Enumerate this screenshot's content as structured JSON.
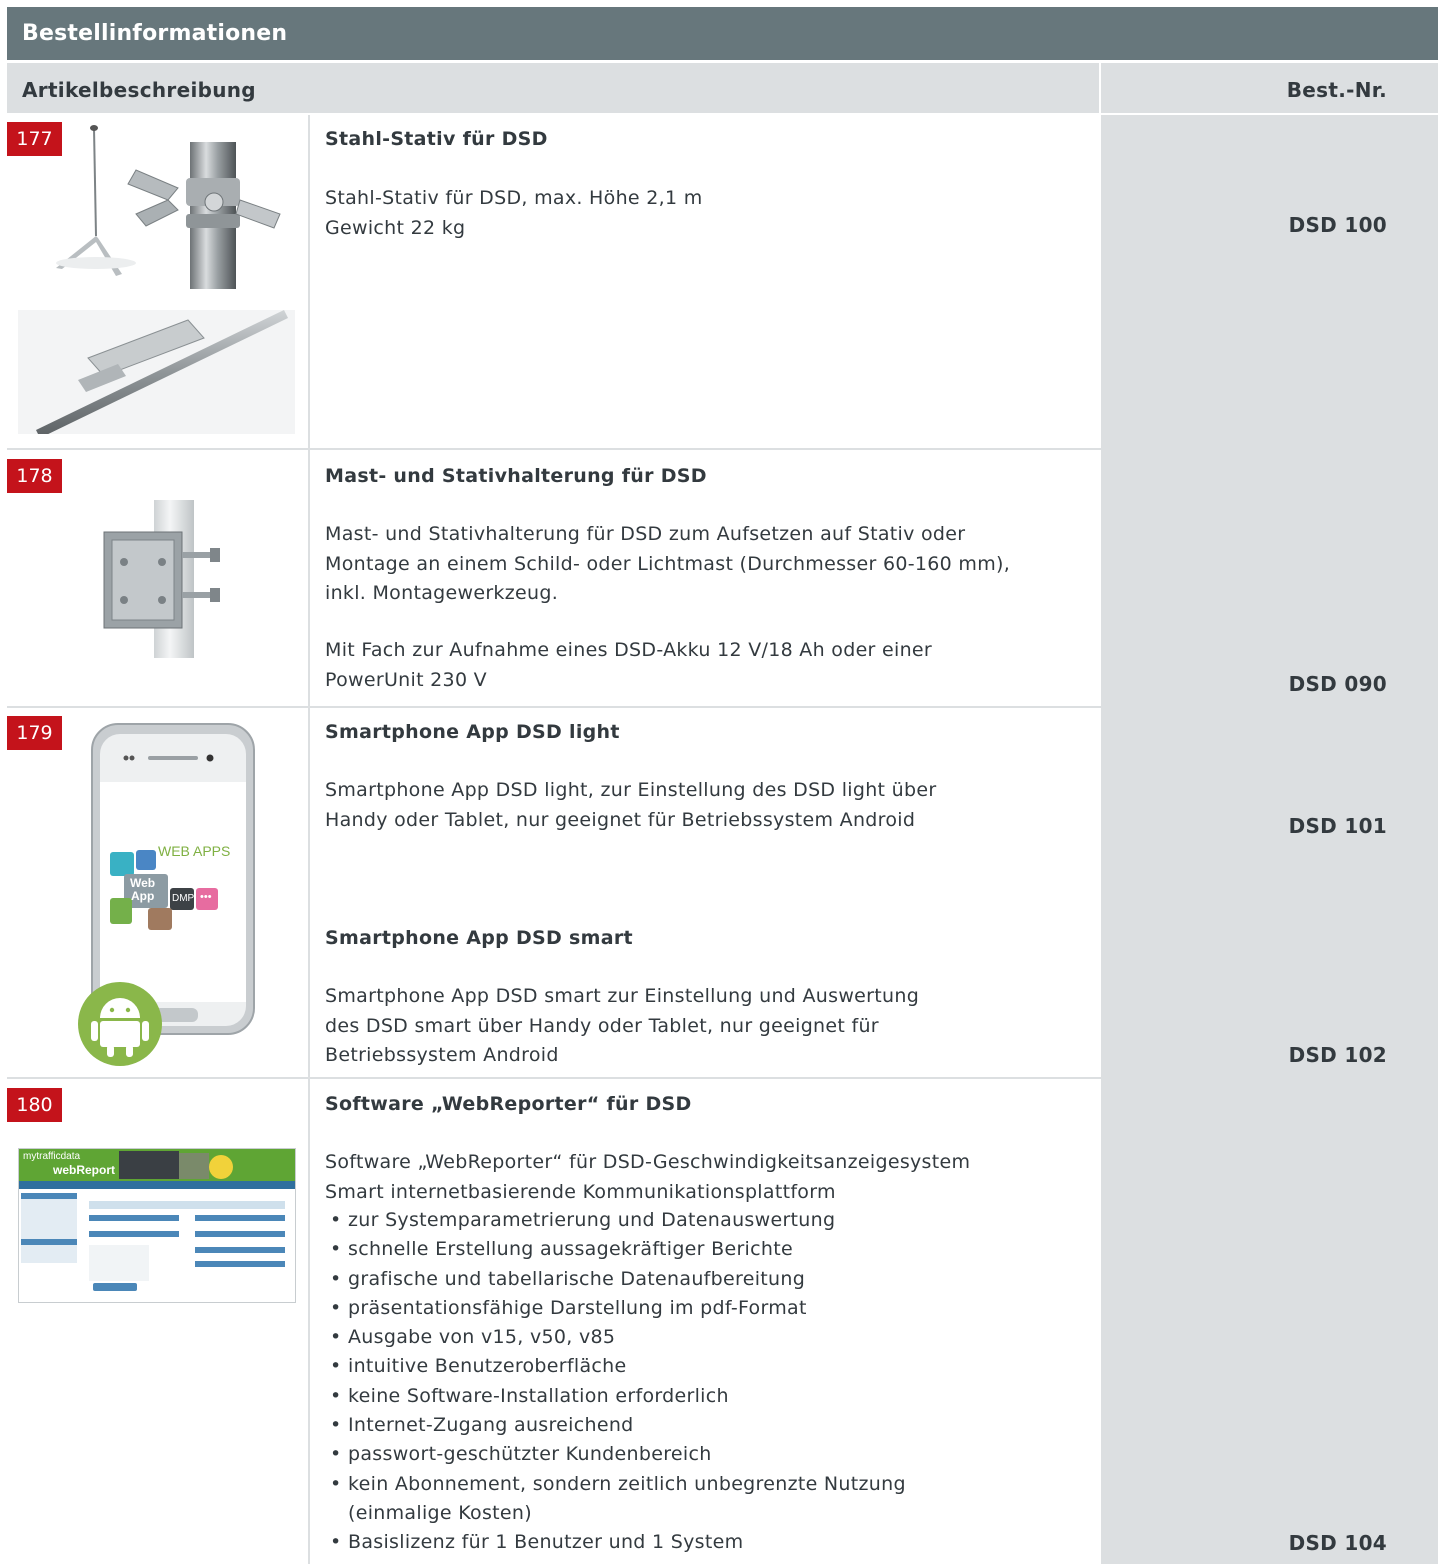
{
  "header": {
    "title": "Bestellinformationen"
  },
  "columns": {
    "description": "Artikelbeschreibung",
    "order_number": "Best.-Nr."
  },
  "items": [
    {
      "number": "177",
      "title": "Stahl-Stativ für DSD",
      "text": [
        "Stahl-Stativ für DSD, max. Höhe 2,1 m",
        "Gewicht 22 kg"
      ],
      "article_no": "DSD 100"
    },
    {
      "number": "178",
      "title": "Mast- und Stativhalterung für DSD",
      "text": [
        "Mast- und Stativhalterung für DSD zum Aufsetzen auf Stativ oder",
        "Montage an einem Schild- oder Lichtmast (Durchmesser 60-160 mm),",
        "inkl. Montagewerkzeug."
      ],
      "text2": [
        "Mit Fach zur Aufnahme eines DSD-Akku 12 V/18 Ah oder einer",
        "PowerUnit 230 V"
      ],
      "article_no": "DSD 090"
    },
    {
      "number": "179",
      "title": "Smartphone App DSD light",
      "text": [
        "Smartphone App DSD light, zur Einstellung des DSD light über",
        "Handy oder Tablet, nur geeignet für Betriebssystem Android"
      ],
      "article_no": "DSD 101",
      "title2": "Smartphone App DSD smart",
      "text2": [
        "Smartphone App DSD smart zur Einstellung und Auswertung",
        "des DSD smart über Handy oder Tablet, nur geeignet für",
        "Betriebssystem Android"
      ],
      "article_no2": "DSD 102",
      "phone_image": {
        "label": "WEB APPS",
        "tile_web": "Web",
        "tile_app": "App",
        "tile_dmp": "DMP",
        "tile_more": "•••"
      }
    },
    {
      "number": "180",
      "title": "Software „WebReporter“ für DSD",
      "text": [
        "Software „WebReporter“ für DSD-Geschwindigkeitsanzeigesystem",
        "Smart internetbasierende Kommunikationsplattform"
      ],
      "bullets": [
        "zur Systemparametrierung und Datenauswertung",
        "schnelle Erstellung aussagekräftiger Berichte",
        "grafische und tabellarische Datenaufbereitung",
        "präsentationsfähige Darstellung im pdf-Format",
        "Ausgabe von v15, v50, v85",
        "intuitive Benutzeroberfläche",
        "keine Software-Installation erforderlich",
        "Internet-Zugang ausreichend",
        "passwort-geschützter Kundenbereich",
        "kein Abonnement, sondern zeitlich unbegrenzte Nutzung",
        "(einmalige Kosten)",
        "Basislizenz für 1 Benutzer und 1 System"
      ],
      "article_no": "DSD 104",
      "screenshot_image": {
        "brand": "mytrafficdata",
        "product": "webReport"
      }
    }
  ],
  "colors": {
    "title_bar": "#67777c",
    "grey": "#dcdfe1",
    "badge": "#c4131b",
    "text": "#333a3f"
  }
}
